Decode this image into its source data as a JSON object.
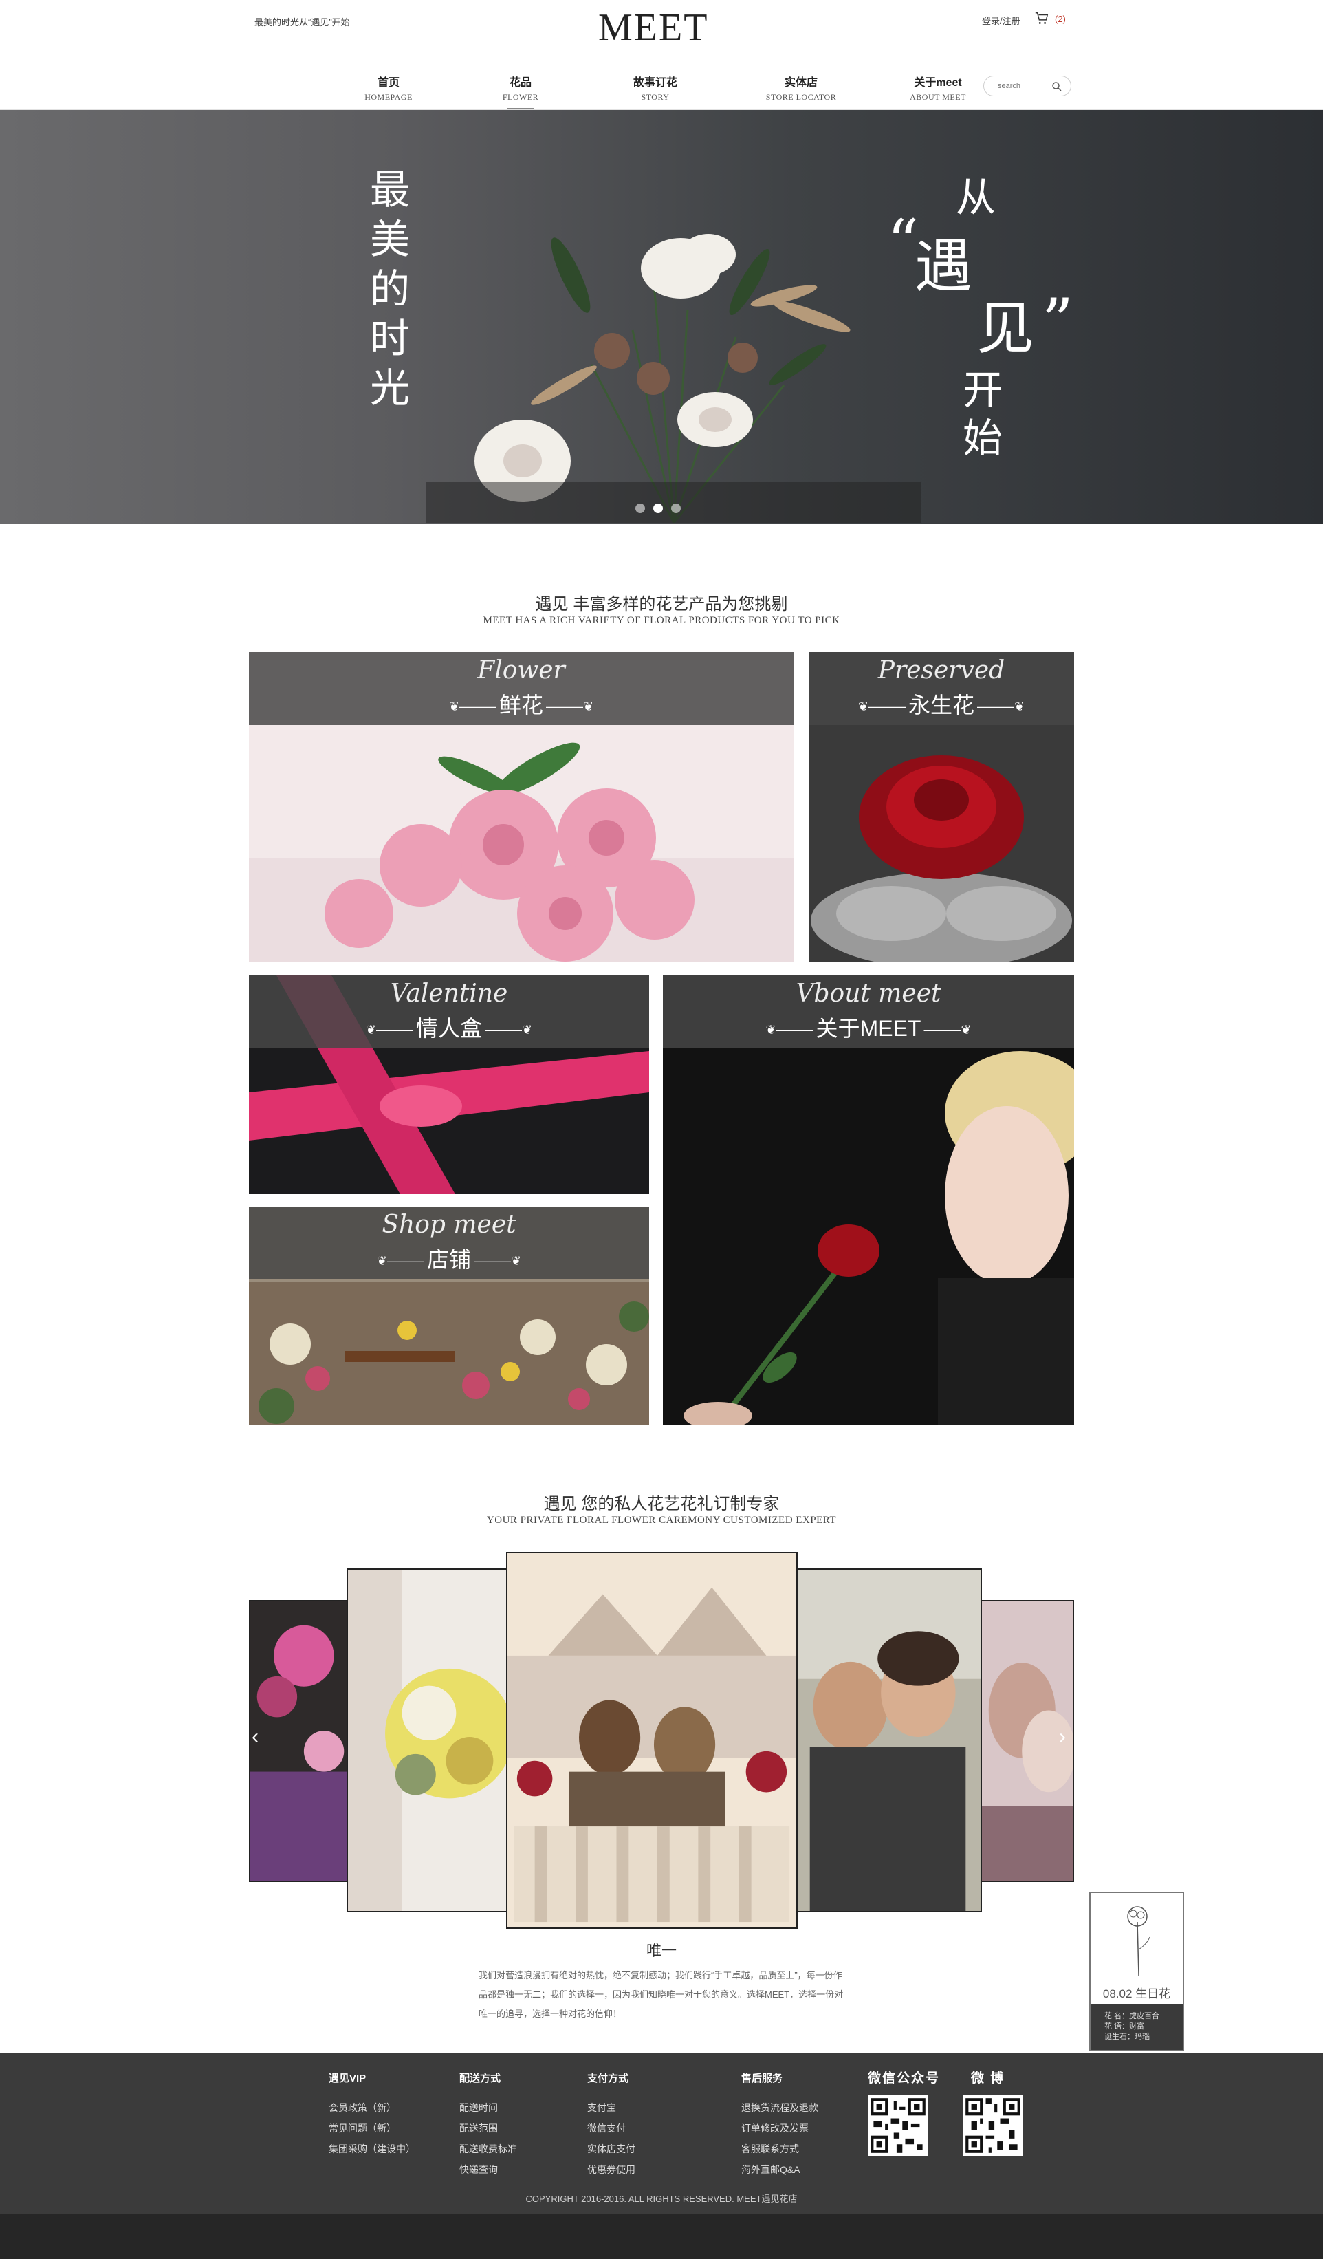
{
  "header": {
    "slogan": "最美的时光从“遇见”开始",
    "logo": "MEET",
    "login": "登录/注册",
    "cart_count": "(2)"
  },
  "nav": [
    {
      "cn": "首页",
      "en": "HOMEPAGE"
    },
    {
      "cn": "花品",
      "en": "FLOWER"
    },
    {
      "cn": "故事订花",
      "en": "STORY"
    },
    {
      "cn": "实体店",
      "en": "STORE LOCATOR"
    },
    {
      "cn": "关于meet",
      "en": "ABOUT MEET"
    }
  ],
  "search": {
    "placeholder": "search"
  },
  "hero": {
    "left_chars": [
      "最",
      "美",
      "的",
      "时",
      "光"
    ],
    "right": {
      "c1": "从",
      "q_open": "“",
      "c2": "遇",
      "c3": "见",
      "q_close": "”",
      "c4": "开",
      "c5": "始"
    }
  },
  "section1": {
    "title": "遇见    丰富多样的花艺产品为您挑剔",
    "subtitle": "MEET HAS A RICH VARIETY OF FLORAL PRODUCTS FOR YOU TO PICK"
  },
  "tiles": [
    {
      "script": "Flower",
      "cn": "鲜花"
    },
    {
      "script": "Preserved",
      "cn": "永生花"
    },
    {
      "script": "Valentine",
      "cn": "情人盒"
    },
    {
      "script": "Vbout meet",
      "cn": "关于MEET"
    },
    {
      "script": "Shop meet",
      "cn": "店铺"
    }
  ],
  "section2": {
    "title": "遇见    您的私人花艺花礼订制专家",
    "subtitle": "YOUR PRIVATE FLORAL FLOWER CAREMONY CUSTOMIZED EXPERT"
  },
  "carousel": {
    "prev": "‹",
    "next": "›"
  },
  "unique": {
    "title": "唯一",
    "text": "我们对营造浪漫拥有绝对的热忱，绝不复制感动；我们践行“手工卓越，品质至上”，每一份作品都是独一无二；我们的选择一，因为我们知晓唯一对于您的意义。选择MEET，选择一份对唯一的追寻，选择一种对花的信仰！"
  },
  "float_widget": {
    "date": "08.02  生日花",
    "lines": [
      "花    名：虎皮百合",
      "花    语：财富",
      "诞生石：玛瑙"
    ]
  },
  "footer": {
    "columns": [
      {
        "title": "遇见VIP",
        "items": [
          "会员政策（新）",
          "常见问题（新）",
          "集团采购（建设中）"
        ]
      },
      {
        "title": "配送方式",
        "items": [
          "配送时间",
          "配送范围",
          "配送收费标准",
          "快递查询"
        ]
      },
      {
        "title": "支付方式",
        "items": [
          "支付宝",
          "微信支付",
          "实体店支付",
          "优惠券使用"
        ]
      },
      {
        "title": "售后服务",
        "items": [
          "退换货流程及退款",
          "订单修改及发票",
          "客服联系方式",
          "海外直邮Q&A"
        ]
      }
    ],
    "wechat": "微信公众号",
    "weibo": "微  博",
    "copyright": "COPYRIGHT 2016-2016. ALL RIGHTS RESERVED. MEET遇见花店"
  },
  "colors": {
    "dark": "#3b3b3b",
    "accent_red": "#c0392b",
    "hero_dark": "#2c2f33"
  }
}
